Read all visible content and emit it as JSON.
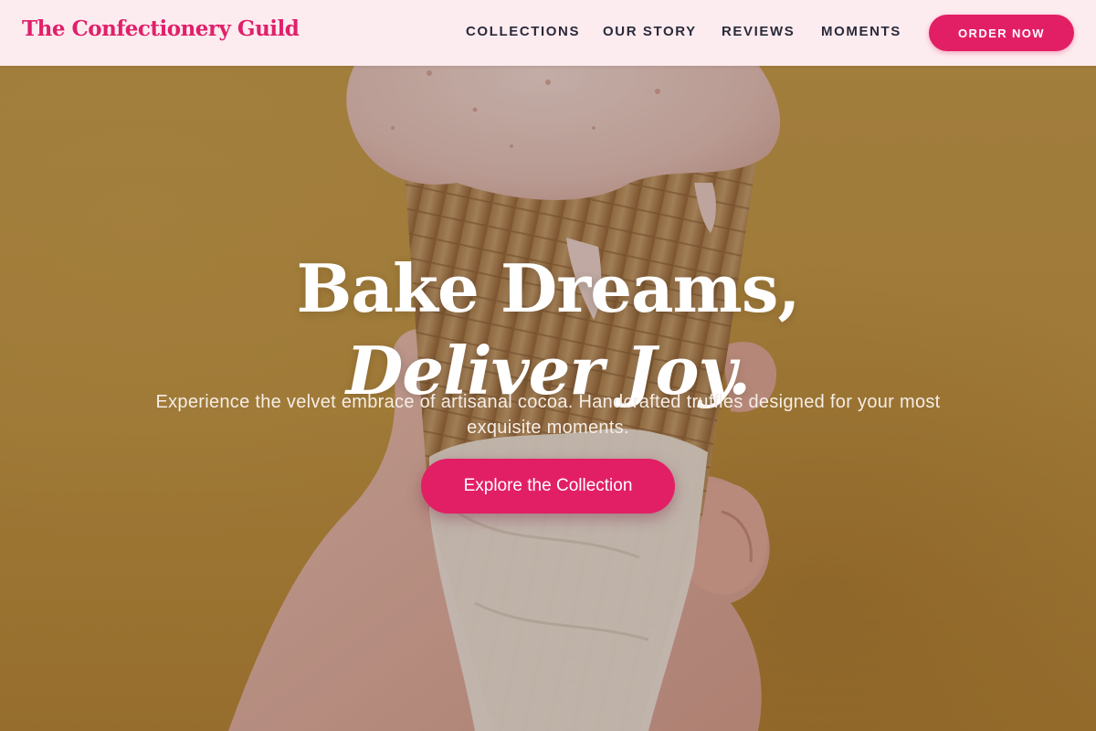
{
  "brand": {
    "name": "The Confectionery Guild"
  },
  "nav": {
    "links": [
      {
        "label": "COLLECTIONS"
      },
      {
        "label": "OUR STORY"
      },
      {
        "label": "REVIEWS"
      },
      {
        "label": "MOMENTS"
      }
    ],
    "order_label": "ORDER NOW"
  },
  "hero": {
    "headline_line1": "Bake Dreams,",
    "headline_line2": "Deliver Joy.",
    "subtitle": "Experience the velvet embrace of artisanal cocoa. Handcrafted truffles designed for your most exquisite moments.",
    "cta_label": "Explore the Collection",
    "image_subject": "hand-holding-ice-cream-cone"
  },
  "colors": {
    "accent": "#e21f65",
    "brand_text": "#e0206b",
    "nav_bg": "#fdecef",
    "nav_text": "#2a2a3a",
    "hero_bg": "#c59a44"
  }
}
